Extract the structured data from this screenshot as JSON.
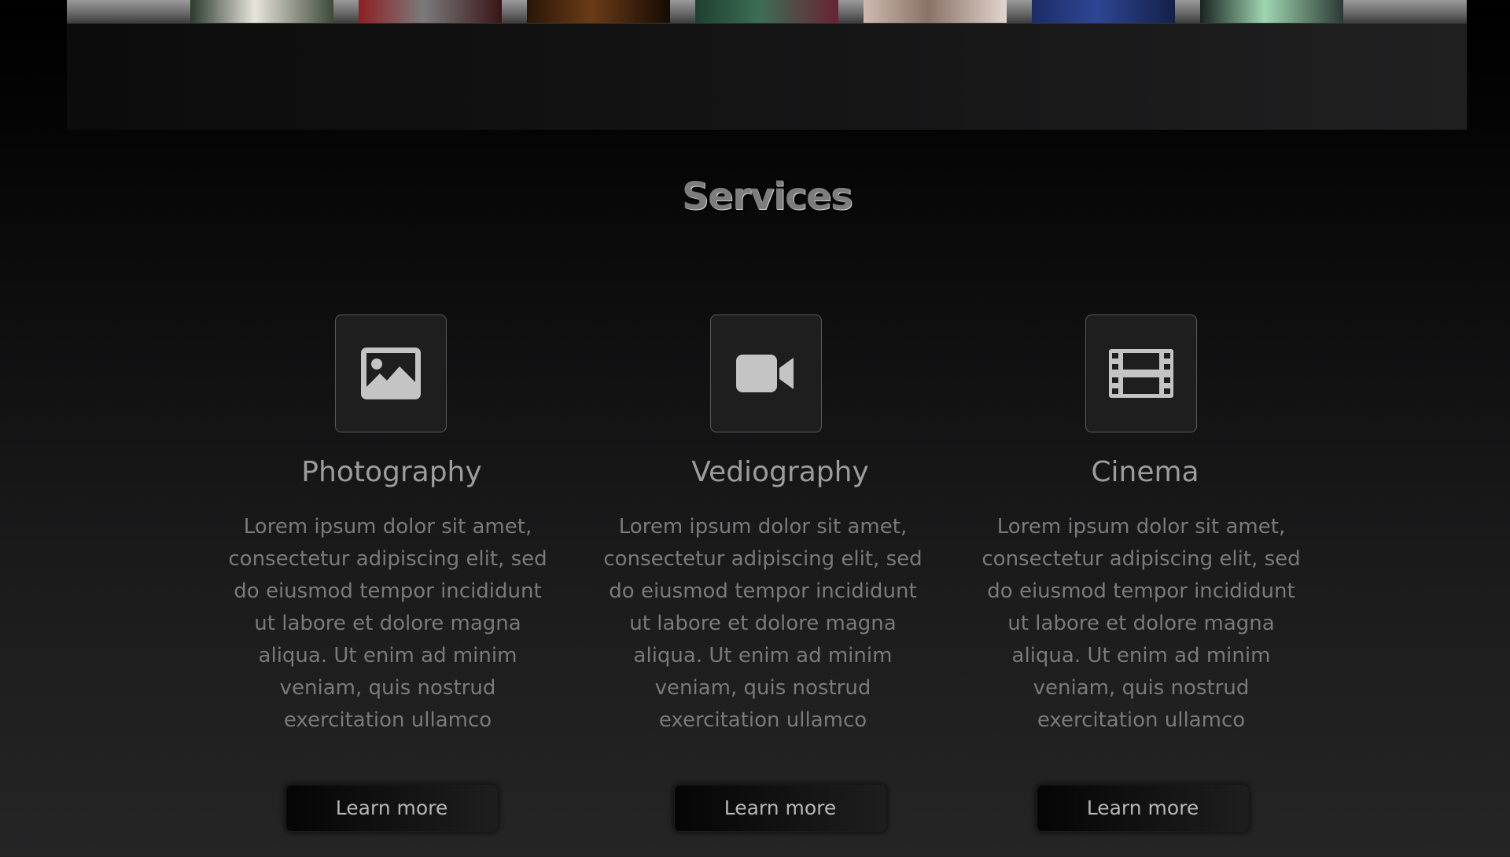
{
  "gallery": {
    "thumbnails": [
      {
        "name": "portrait-white",
        "colors": [
          "#2b3a2c",
          "#e8e4dc",
          "#3d4a38"
        ]
      },
      {
        "name": "portrait-rose",
        "colors": [
          "#8e1f22",
          "#7b7b7b",
          "#3a1416"
        ]
      },
      {
        "name": "portrait-brown",
        "colors": [
          "#2a1608",
          "#6b3b17",
          "#150b04"
        ]
      },
      {
        "name": "portrait-green-floral",
        "colors": [
          "#1f4030",
          "#3c6e55",
          "#6a2233"
        ]
      },
      {
        "name": "portrait-lace",
        "colors": [
          "#cdbab0",
          "#8a7268",
          "#e2d5cd"
        ]
      },
      {
        "name": "portrait-blue",
        "colors": [
          "#1b2c66",
          "#2e4694",
          "#142048"
        ]
      },
      {
        "name": "portrait-mint",
        "colors": [
          "#1a2320",
          "#9fd6b0",
          "#2b3a34"
        ]
      }
    ]
  },
  "services": {
    "title": "Services",
    "items": [
      {
        "icon": "image-icon",
        "title": "Photography",
        "description": "Lorem ipsum dolor sit amet, consectetur adipiscing elit, sed do eiusmod tempor incididunt ut labore et dolore magna aliqua. Ut enim ad minim veniam, quis nostrud exercitation ullamco",
        "button_label": "Learn more"
      },
      {
        "icon": "video-camera-icon",
        "title": "Vediography",
        "description": "Lorem ipsum dolor sit amet, consectetur adipiscing elit, sed do eiusmod tempor incididunt ut labore et dolore magna aliqua. Ut enim ad minim veniam, quis nostrud exercitation ullamco",
        "button_label": "Learn more"
      },
      {
        "icon": "film-icon",
        "title": "Cinema",
        "description": "Lorem ipsum dolor sit amet, consectetur adipiscing elit, sed do eiusmod tempor incididunt ut labore et dolore magna aliqua. Ut enim ad minim veniam, quis nostrud exercitation ullamco",
        "button_label": "Learn more"
      }
    ]
  },
  "colors": {
    "background_top": "#000000",
    "background_bottom": "#252526",
    "icon_fill": "#c4c4c4",
    "icon_box_border": "#5a5a5a",
    "text": "#7a7a7a"
  }
}
